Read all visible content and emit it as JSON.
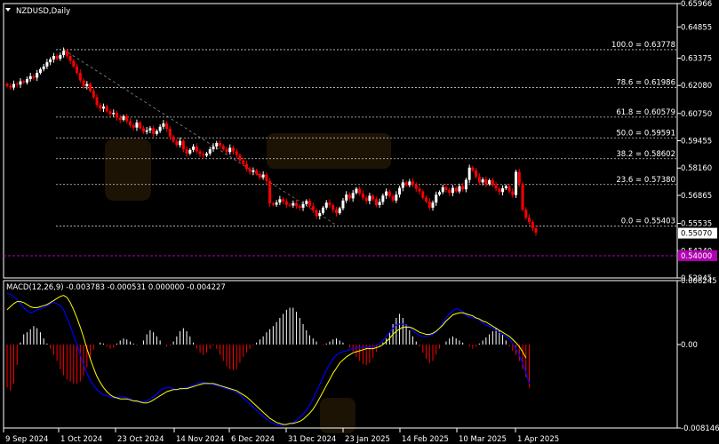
{
  "symbol_label": "NZDUSD,Daily",
  "macd_label": "MACD(12,26,9) -0.003783 -0.000531 0.000000 -0.004227",
  "colors": {
    "background": "#000000",
    "grid": "#ffffff",
    "bull_candle": "#ffffff",
    "bear_candle": "#ff0000",
    "macd_line": "#0000ff",
    "signal_line": "#ffff00",
    "support_line": "#b000b0",
    "current_price_box": "#ffffff",
    "support_box": "#b000b0"
  },
  "chart_data": [
    {
      "type": "candlestick",
      "title": "NZDUSD,Daily",
      "ylim": [
        0.52945,
        0.65966
      ],
      "y_ticks": [
        "0.65966",
        "0.64855",
        "0.63375",
        "0.62080",
        "0.60750",
        "0.59455",
        "0.58160",
        "0.56865",
        "0.55535",
        "0.54240",
        "0.52945"
      ],
      "x_ticks": [
        "9 Sep 2024",
        "1 Oct 2024",
        "23 Oct 2024",
        "14 Nov 2024",
        "6 Dec 2024",
        "31 Dec 2024",
        "23 Jan 2025",
        "14 Feb 2025",
        "10 Mar 2025",
        "1 Apr 2025"
      ],
      "current_price": "0.55070",
      "support_level": "0.54000",
      "fibonacci_levels": [
        {
          "label": "100.0 = 0.63778",
          "value": 0.63778
        },
        {
          "label": "78.6 = 0.61986",
          "value": 0.61986
        },
        {
          "label": "61.8 = 0.60579",
          "value": 0.60579
        },
        {
          "label": "50.0 = 0.59591",
          "value": 0.59591
        },
        {
          "label": "38.2 = 0.58602",
          "value": 0.58602
        },
        {
          "label": "23.6 = 0.57380",
          "value": 0.5738
        },
        {
          "label": "0.0 = 0.55403",
          "value": 0.55403
        }
      ],
      "trendline": {
        "from": 0.6378,
        "to": 0.5545
      },
      "close": [
        0.6205,
        0.6198,
        0.6215,
        0.6212,
        0.6228,
        0.6222,
        0.6238,
        0.6252,
        0.6245,
        0.6268,
        0.6285,
        0.6298,
        0.6318,
        0.6332,
        0.6348,
        0.6335,
        0.6352,
        0.6372,
        0.6348,
        0.6325,
        0.6298,
        0.6268,
        0.6232,
        0.6205,
        0.6215,
        0.6182,
        0.6152,
        0.6115,
        0.6098,
        0.6108,
        0.6085,
        0.6072,
        0.6078,
        0.6055,
        0.6045,
        0.6062,
        0.6038,
        0.602,
        0.6008,
        0.6032,
        0.6005,
        0.5988,
        0.5995,
        0.6005,
        0.5978,
        0.5992,
        0.6012,
        0.6028,
        0.6002,
        0.5965,
        0.5942,
        0.5925,
        0.5945,
        0.5905,
        0.5885,
        0.5902,
        0.5918,
        0.5895,
        0.5882,
        0.5875,
        0.5885,
        0.5905,
        0.5918,
        0.5935,
        0.5922,
        0.5905,
        0.5892,
        0.5912,
        0.5895,
        0.5878,
        0.5852,
        0.5835,
        0.5812,
        0.5798,
        0.5805,
        0.5788,
        0.5772,
        0.5785,
        0.5755,
        0.5648,
        0.5642,
        0.5652,
        0.5668,
        0.5658,
        0.5642,
        0.5638,
        0.565,
        0.5635,
        0.5628,
        0.5645,
        0.566,
        0.5635,
        0.5615,
        0.5588,
        0.5602,
        0.5628,
        0.5652,
        0.564,
        0.5618,
        0.5602,
        0.5625,
        0.5662,
        0.569,
        0.5672,
        0.5698,
        0.5718,
        0.5695,
        0.5675,
        0.566,
        0.5685,
        0.5668,
        0.564,
        0.5655,
        0.5685,
        0.5705,
        0.5682,
        0.5662,
        0.569,
        0.5722,
        0.5748,
        0.5735,
        0.5752,
        0.5738,
        0.5718,
        0.5705,
        0.5675,
        0.5658,
        0.5628,
        0.5652,
        0.569,
        0.5702,
        0.5725,
        0.5712,
        0.5698,
        0.5722,
        0.5705,
        0.573,
        0.5715,
        0.576,
        0.5818,
        0.5805,
        0.5775,
        0.5748,
        0.5762,
        0.574,
        0.5758,
        0.5735,
        0.5718,
        0.5702,
        0.572,
        0.573,
        0.5705,
        0.5688,
        0.5798,
        0.5742,
        0.5618,
        0.558,
        0.556,
        0.553,
        0.551
      ],
      "macd_panel": {
        "ylim": [
          -0.008146,
          0.006245
        ],
        "y_ticks": [
          "0.006245",
          "0.00",
          "-0.008146"
        ],
        "macd": [
          0.005,
          0.0049,
          0.0047,
          0.0044,
          0.004,
          0.0036,
          0.0033,
          0.0031,
          0.0032,
          0.0034,
          0.0035,
          0.0036,
          0.0038,
          0.004,
          0.0041,
          0.004,
          0.0038,
          0.0034,
          0.0026,
          0.0018,
          0.0009,
          0.0,
          -0.001,
          -0.002,
          -0.0028,
          -0.0035,
          -0.004,
          -0.0044,
          -0.0047,
          -0.0049,
          -0.005,
          -0.0051,
          -0.0052,
          -0.0052,
          -0.0051,
          -0.0051,
          -0.0052,
          -0.0053,
          -0.0055,
          -0.0056,
          -0.0056,
          -0.0056,
          -0.0055,
          -0.0053,
          -0.0051,
          -0.0048,
          -0.0045,
          -0.0043,
          -0.0042,
          -0.0042,
          -0.0043,
          -0.0044,
          -0.0044,
          -0.0043,
          -0.0042,
          -0.0041,
          -0.004,
          -0.0038,
          -0.0037,
          -0.0037,
          -0.0037,
          -0.0038,
          -0.0039,
          -0.004,
          -0.0041,
          -0.0042,
          -0.0043,
          -0.0044,
          -0.0045,
          -0.0047,
          -0.0049,
          -0.0052,
          -0.0055,
          -0.0058,
          -0.0061,
          -0.0064,
          -0.0067,
          -0.007,
          -0.0073,
          -0.0075,
          -0.0077,
          -0.0078,
          -0.0079,
          -0.0079,
          -0.0078,
          -0.0077,
          -0.0076,
          -0.0074,
          -0.0071,
          -0.0068,
          -0.0064,
          -0.0059,
          -0.0053,
          -0.0046,
          -0.0039,
          -0.0032,
          -0.0025,
          -0.0019,
          -0.0014,
          -0.001,
          -0.0008,
          -0.0007,
          -0.0006,
          -0.0005,
          -0.0004,
          -0.0003,
          -0.0003,
          -0.0003,
          -0.0003,
          -0.0003,
          -0.0002,
          -0.0001,
          0.0001,
          0.0004,
          0.0008,
          0.0012,
          0.0016,
          0.0019,
          0.002,
          0.002,
          0.0019,
          0.0017,
          0.0014,
          0.0011,
          0.0009,
          0.0008,
          0.0008,
          0.0009,
          0.001,
          0.0012,
          0.0016,
          0.0021,
          0.0026,
          0.003,
          0.0033,
          0.0035,
          0.0034,
          0.0032,
          0.0029,
          0.0027,
          0.0026,
          0.0026,
          0.0024,
          0.0021,
          0.0019,
          0.0018,
          0.0016,
          0.0014,
          0.0012,
          0.001,
          0.0008,
          0.0005,
          0.0001,
          -0.0004,
          -0.001,
          -0.0018,
          -0.0027,
          -0.0038
        ],
        "signal": [
          0.0034,
          0.0037,
          0.004,
          0.0042,
          0.0042,
          0.0041,
          0.0039,
          0.0037,
          0.0036,
          0.0036,
          0.0037,
          0.0038,
          0.0039,
          0.0041,
          0.0043,
          0.0045,
          0.0047,
          0.0048,
          0.0046,
          0.0041,
          0.0034,
          0.0026,
          0.0017,
          0.0007,
          -0.0004,
          -0.0014,
          -0.0023,
          -0.0031,
          -0.0037,
          -0.0042,
          -0.0046,
          -0.0049,
          -0.0051,
          -0.0052,
          -0.0053,
          -0.0053,
          -0.0053,
          -0.0054,
          -0.0055,
          -0.0055,
          -0.0056,
          -0.0057,
          -0.0057,
          -0.0056,
          -0.0054,
          -0.0052,
          -0.005,
          -0.0048,
          -0.0046,
          -0.0045,
          -0.0044,
          -0.0044,
          -0.0043,
          -0.0043,
          -0.0043,
          -0.0042,
          -0.0041,
          -0.004,
          -0.0039,
          -0.0038,
          -0.0038,
          -0.0038,
          -0.0038,
          -0.0039,
          -0.004,
          -0.0041,
          -0.0042,
          -0.0043,
          -0.0044,
          -0.0045,
          -0.0047,
          -0.0049,
          -0.0051,
          -0.0054,
          -0.0057,
          -0.006,
          -0.0063,
          -0.0066,
          -0.0069,
          -0.0072,
          -0.0074,
          -0.0076,
          -0.0077,
          -0.0078,
          -0.0078,
          -0.0077,
          -0.0077,
          -0.0076,
          -0.0075,
          -0.0073,
          -0.007,
          -0.0067,
          -0.0063,
          -0.0058,
          -0.0052,
          -0.0046,
          -0.004,
          -0.0034,
          -0.0028,
          -0.0023,
          -0.0018,
          -0.0015,
          -0.0012,
          -0.001,
          -0.0008,
          -0.0007,
          -0.0006,
          -0.0005,
          -0.0004,
          -0.0004,
          -0.0004,
          -0.0003,
          -0.0002,
          0.0,
          0.0003,
          0.0006,
          0.001,
          0.0013,
          0.0015,
          0.0017,
          0.0017,
          0.0017,
          0.0016,
          0.0014,
          0.0012,
          0.0011,
          0.001,
          0.001,
          0.0011,
          0.0013,
          0.0016,
          0.0019,
          0.0023,
          0.0026,
          0.0029,
          0.003,
          0.0031,
          0.0031,
          0.003,
          0.0029,
          0.0028,
          0.0026,
          0.0025,
          0.0023,
          0.0022,
          0.002,
          0.0018,
          0.0016,
          0.0014,
          0.0012,
          0.001,
          0.0008,
          0.0005,
          0.0002,
          -0.0002,
          -0.0007,
          -0.0013
        ],
        "histogram": [
          -0.0042,
          -0.0045,
          -0.0038,
          -0.002,
          0.0002,
          0.001,
          0.0012,
          0.0015,
          0.0018,
          0.0016,
          0.0012,
          0.0006,
          0.0001,
          -0.0004,
          -0.001,
          -0.0016,
          -0.0024,
          -0.003,
          -0.0034,
          -0.0036,
          -0.0038,
          -0.0038,
          -0.0036,
          -0.003,
          -0.0022,
          -0.0013,
          -0.0005,
          0.0,
          0.0002,
          0.0001,
          -0.0002,
          -0.0004,
          -0.0003,
          0.0001,
          0.0004,
          0.0006,
          0.0005,
          0.0003,
          0.0001,
          -0.0001,
          0.0,
          0.0004,
          0.001,
          0.0014,
          0.0012,
          0.0008,
          0.0004,
          0.0,
          -0.0002,
          -0.0001,
          0.0003,
          0.0008,
          0.0013,
          0.0016,
          0.0013,
          0.0008,
          0.0002,
          -0.0004,
          -0.0008,
          -0.001,
          -0.0008,
          -0.0004,
          -0.0001,
          -0.0004,
          -0.001,
          -0.0016,
          -0.0021,
          -0.0024,
          -0.0025,
          -0.0024,
          -0.0018,
          -0.0012,
          -0.0008,
          -0.0004,
          -0.0001,
          0.0002,
          0.0005,
          0.0008,
          0.0012,
          0.0015,
          0.0018,
          0.0022,
          0.0026,
          0.003,
          0.0034,
          0.0036,
          0.0036,
          0.0032,
          0.0026,
          0.002,
          0.0014,
          0.0009,
          0.0006,
          0.0003,
          0.0,
          -0.0001,
          0.0001,
          0.0003,
          0.0005,
          0.0006,
          0.0004,
          0.0002,
          0.0,
          -0.0003,
          -0.0007,
          -0.0012,
          -0.0016,
          -0.0019,
          -0.002,
          -0.0018,
          -0.0013,
          -0.0007,
          -0.0002,
          0.0002,
          0.0006,
          0.0012,
          0.002,
          0.0026,
          0.003,
          0.0026,
          0.002,
          0.0014,
          0.0008,
          0.0003,
          -0.0002,
          -0.0008,
          -0.0014,
          -0.0018,
          -0.0016,
          -0.001,
          -0.0004,
          0.0,
          0.0003,
          0.0006,
          0.0008,
          0.0006,
          0.0004,
          0.0002,
          0.0,
          -0.0002,
          -0.0004,
          -0.0002,
          0.0001,
          0.0004,
          0.0007,
          0.001,
          0.0013,
          0.0016,
          0.0014,
          0.001,
          0.0004,
          -0.0002,
          -0.0006,
          -0.001,
          -0.0016,
          -0.0024,
          -0.0032,
          -0.0042
        ]
      }
    }
  ]
}
